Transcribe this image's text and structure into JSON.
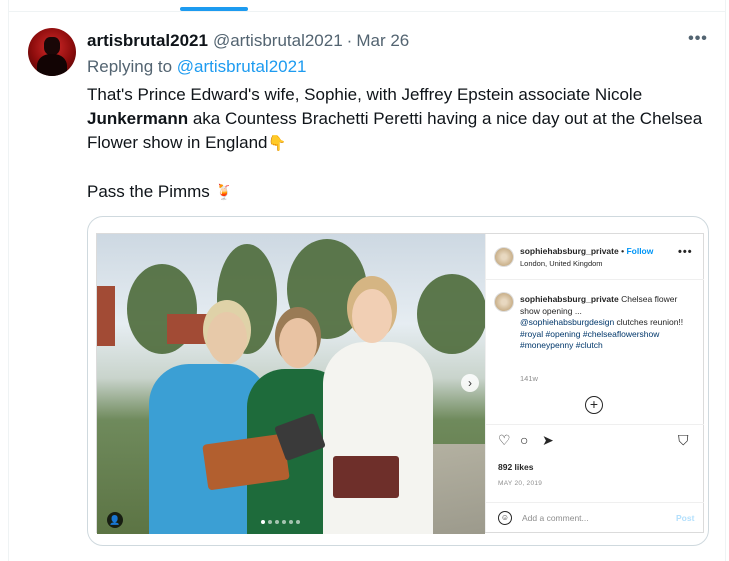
{
  "tweet": {
    "display_name": "artisbrutal2021",
    "handle": "@artisbrutal2021",
    "separator": "·",
    "date": "Mar 26",
    "more_label": "•••",
    "replying_prefix": "Replying to",
    "replying_to": "@artisbrutal2021",
    "text_part1": "That's Prince Edward's wife, Sophie, with Jeffrey Epstein associate Nicole ",
    "text_bold": "Junkermann",
    "text_part2": " aka Countess Brachetti Peretti having a nice day out at the Chelsea Flower show in England",
    "text_emoji1": "👇",
    "text_line2": "Pass the Pimms",
    "text_emoji2": "🍹"
  },
  "instagram": {
    "username": "sophiehabsburg_private",
    "separator": "•",
    "follow_label": "Follow",
    "location": "London, United Kingdom",
    "more_label": "•••",
    "caption_user": "sophiehabsburg_private",
    "caption_text": " Chelsea flower show opening ...",
    "caption_mention": "@sophiehabsburgdesign",
    "caption_mention_rest": " clutches reunion!! ",
    "caption_tags": "#royal #opening #chelseaflowershow #moneypenny #clutch",
    "caption_age": "141w",
    "add_icon": "+",
    "like_icon": "♡",
    "comment_icon": "○",
    "share_icon": "➤",
    "save_icon": "⛉",
    "likes": "892 likes",
    "post_date": "MAY 20, 2019",
    "comment_placeholder": "Add a comment...",
    "post_label": "Post",
    "next_arrow": "›",
    "tag_icon": "👤"
  }
}
